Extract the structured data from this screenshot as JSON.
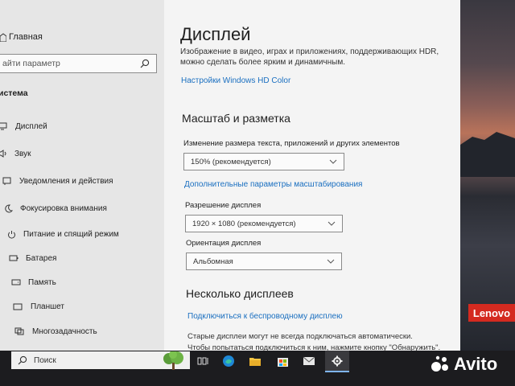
{
  "sidebar": {
    "home_label": "Главная",
    "search_placeholder": "айти параметр",
    "section_title": "истема",
    "items": [
      {
        "label": "Дисплей",
        "icon": "monitor-icon"
      },
      {
        "label": "Звук",
        "icon": "speaker-icon"
      },
      {
        "label": "Уведомления и действия",
        "icon": "notification-icon"
      },
      {
        "label": "Фокусировка внимания",
        "icon": "moon-icon"
      },
      {
        "label": "Питание и спящий режим",
        "icon": "power-icon"
      },
      {
        "label": "Батарея",
        "icon": "battery-icon"
      },
      {
        "label": "Память",
        "icon": "storage-icon"
      },
      {
        "label": "Планшет",
        "icon": "tablet-icon"
      },
      {
        "label": "Многозадачность",
        "icon": "multitasking-icon"
      }
    ]
  },
  "main": {
    "title": "Дисплей",
    "hdr_description": "Изображение в видео, играх и приложениях, поддерживающих HDR, можно сделать более ярким и динамичным.",
    "hdr_link": "Настройки Windows HD Color",
    "scale_heading": "Масштаб и разметка",
    "scale_label": "Изменение размера текста, приложений и других элементов",
    "scale_value": "150% (рекомендуется)",
    "advanced_scale_link": "Дополнительные параметры масштабирования",
    "resolution_label": "Разрешение дисплея",
    "resolution_value": "1920 × 1080 (рекомендуется)",
    "orientation_label": "Ориентация дисплея",
    "orientation_value": "Альбомная",
    "multi_heading": "Несколько дисплеев",
    "wireless_link": "Подключиться к беспроводному дисплею",
    "old_displays_text_1": "Старые дисплеи могут не всегда подключаться автоматически.",
    "old_displays_text_2": "Чтобы попытаться подключиться к ним, нажмите кнопку \"Обнаружить\"."
  },
  "desktop": {
    "lenovo_badge": "Lenovo"
  },
  "taskbar": {
    "search_label": "Поиск",
    "icons": [
      "task-view-icon",
      "edge-icon",
      "file-explorer-icon",
      "store-icon",
      "mail-icon",
      "settings-icon"
    ]
  },
  "watermark": {
    "text": "Avito"
  },
  "colors": {
    "link": "#1a6fc0",
    "lenovo": "#d42a20",
    "taskbar": "#1c1c1f"
  }
}
